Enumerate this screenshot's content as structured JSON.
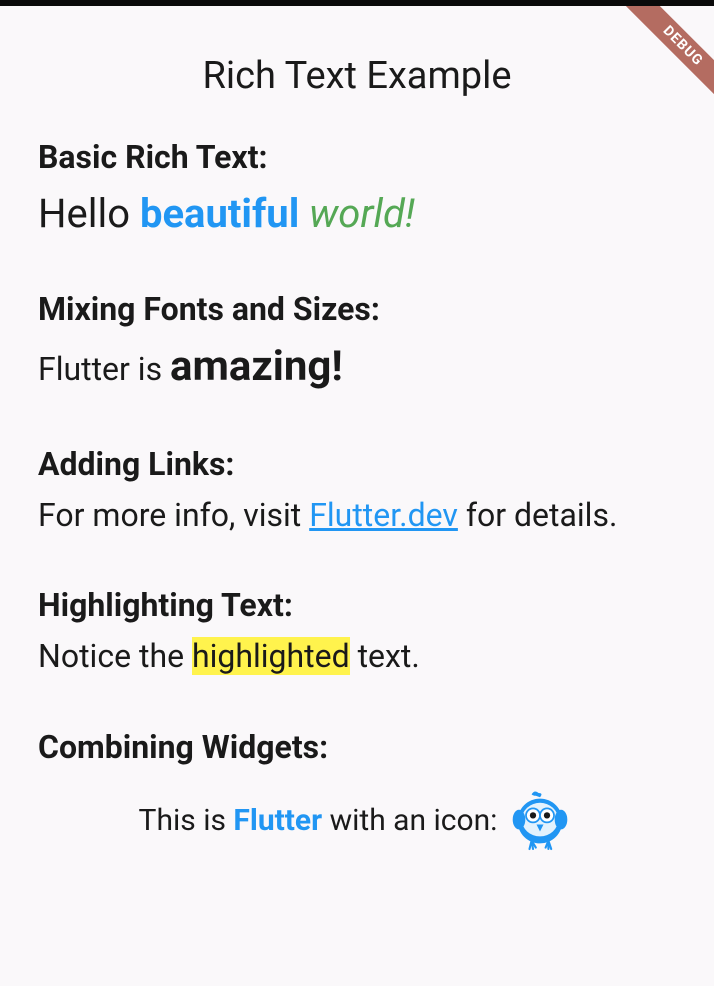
{
  "debugBanner": "DEBUG",
  "appTitle": "Rich Text Example",
  "sections": {
    "basic": {
      "title": "Basic Rich Text:",
      "text1": "Hello ",
      "text2": "beautiful",
      "text3": " world!"
    },
    "fonts": {
      "title": "Mixing Fonts and Sizes:",
      "text1": "Flutter is ",
      "text2": "amazing!"
    },
    "links": {
      "title": "Adding Links:",
      "text1": "For more info, visit ",
      "linkText": "Flutter.dev",
      "text2": " for details."
    },
    "highlight": {
      "title": "Highlighting Text:",
      "text1": "Notice the ",
      "text2": "highlighted",
      "text3": " text."
    },
    "widgets": {
      "title": "Combining Widgets:",
      "text1": "This is ",
      "text2": "Flutter",
      "text3": " with an icon: "
    }
  }
}
